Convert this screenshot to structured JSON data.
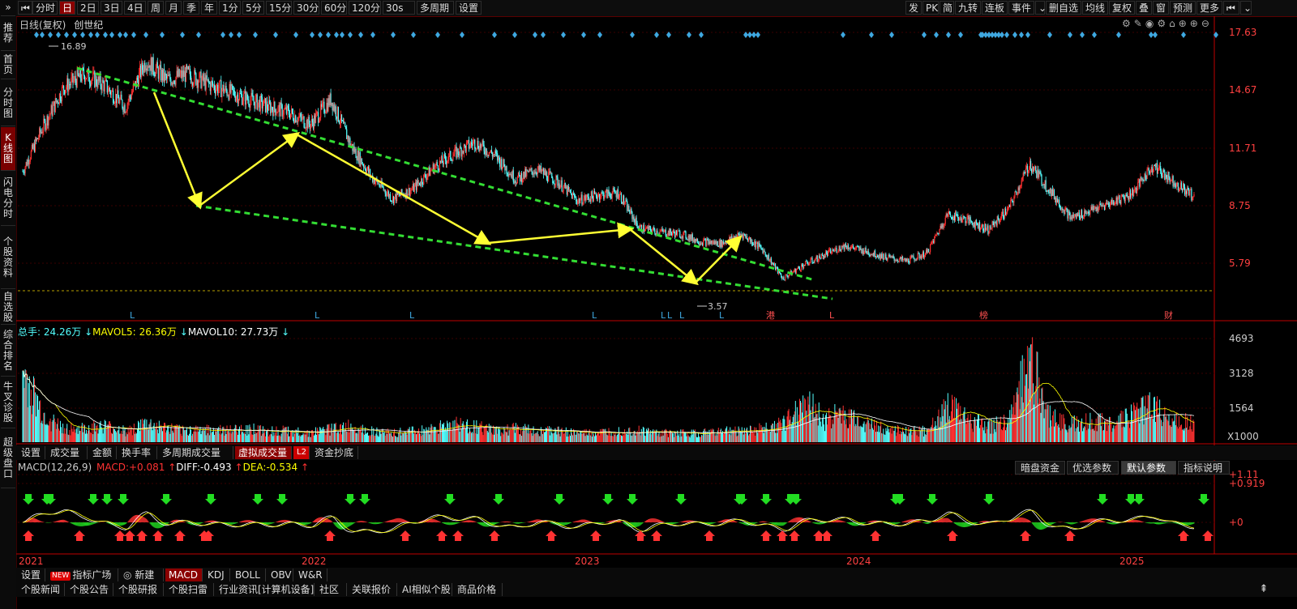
{
  "colors": {
    "up": "#ff3232",
    "down": "#54ffff",
    "grid": "#3a0000",
    "axis": "#c00000",
    "mavol5": "#ffff00",
    "mavol10": "#ffffff",
    "trend": "#33dd33",
    "arrow": "#ffff33",
    "diff": "#ffffff",
    "dea": "#ffff00"
  },
  "sidebar": {
    "items": [
      "推荐",
      "首页",
      "分时图",
      "K线图",
      "闪电分时",
      "个股资料",
      "自选股",
      "综合排名",
      "牛叉诊股",
      "超级盘口"
    ],
    "collapse_icon": "»"
  },
  "toolbar": {
    "prev_icon": "⏮",
    "left": [
      "分时",
      "日",
      "2日",
      "3日",
      "4日",
      "周",
      "月",
      "季",
      "年",
      "1分",
      "5分",
      "15分",
      "30分",
      "60分",
      "120分",
      "30s",
      "多周期",
      "设置"
    ],
    "right": [
      "发",
      "PK",
      "简",
      "九转",
      "连板",
      "事件",
      "⌄",
      "删自选",
      "均线",
      "复权",
      "叠",
      "窗",
      "预测",
      "更多",
      "⏮",
      "⌄"
    ]
  },
  "main": {
    "title": "日线(复权)",
    "stock": "创世纪",
    "y_labels": [
      "17.63",
      "14.67",
      "11.71",
      "8.75",
      "5.79"
    ],
    "high_label": "16.89",
    "low_label": "3.57",
    "markers": [
      "L",
      "L",
      "L",
      "L",
      "L",
      "L",
      "L",
      "L",
      "港",
      "L",
      "榜",
      "财"
    ],
    "tool_icons": [
      "gear-icon",
      "pen-icon",
      "eye-icon",
      "settings-icon",
      "home-icon",
      "add-icon",
      "zoom-in-icon",
      "zoom-out-icon"
    ]
  },
  "volume": {
    "total_label": "总手:",
    "total": "24.26万",
    "mavol5_label": "MAVOL5:",
    "mavol5": "26.36万",
    "mavol10_label": "MAVOL10:",
    "mavol10": "27.73万",
    "y_labels": [
      "4693",
      "3128",
      "1564",
      "X1000"
    ]
  },
  "sub_tabs": [
    "设置",
    "成交量",
    "金额",
    "换手率",
    "多周期成交量",
    "虚拟成交量",
    "L2",
    "资金抄底"
  ],
  "macd": {
    "title": "MACD(12,26,9)",
    "macd_label": "MACD:",
    "macd_val": "+0.081",
    "diff_label": "DIFF:",
    "diff_val": "-0.493",
    "dea_label": "DEA:",
    "dea_val": "-0.534",
    "y_labels": [
      "+1.11",
      "+0.919",
      "+0"
    ],
    "buttons": [
      "暗盘资金",
      "优选参数",
      "默认参数",
      "指标说明"
    ]
  },
  "x_labels": [
    "2021",
    "2022",
    "2023",
    "2024",
    "2025"
  ],
  "indicator_tabs": [
    "设置",
    "指标广场",
    "新建",
    "MACD",
    "KDJ",
    "BOLL",
    "OBV",
    "W&R"
  ],
  "new_badge": "NEW",
  "news_tabs": [
    "个股新闻",
    "个股公告",
    "个股研报",
    "个股扫雷",
    "行业资讯[计算机设备]",
    "社区",
    "关联报价",
    "AI相似个股",
    "商品价格"
  ],
  "chart_data": {
    "type": "candlestick",
    "title": "日线(复权) 创世纪",
    "x_axis": [
      "2021",
      "2022",
      "2023",
      "2024",
      "2025"
    ],
    "price_axis": [
      17.63,
      14.67,
      11.71,
      8.75,
      5.79
    ],
    "monthly_close": [
      {
        "x": "2021-01",
        "y": 10.5
      },
      {
        "x": "2021-02",
        "y": 12.8
      },
      {
        "x": "2021-03",
        "y": 14.8
      },
      {
        "x": "2021-04",
        "y": 15.5
      },
      {
        "x": "2021-05",
        "y": 14.9
      },
      {
        "x": "2021-06",
        "y": 13.8
      },
      {
        "x": "2021-07",
        "y": 16.2
      },
      {
        "x": "2021-08",
        "y": 15.2
      },
      {
        "x": "2021-09",
        "y": 15.5
      },
      {
        "x": "2021-10",
        "y": 15.0
      },
      {
        "x": "2021-11",
        "y": 14.6
      },
      {
        "x": "2021-12",
        "y": 14.2
      },
      {
        "x": "2022-01",
        "y": 13.8
      },
      {
        "x": "2022-02",
        "y": 13.5
      },
      {
        "x": "2022-03",
        "y": 12.9
      },
      {
        "x": "2022-04",
        "y": 14.2
      },
      {
        "x": "2022-05",
        "y": 11.8
      },
      {
        "x": "2022-06",
        "y": 10.2
      },
      {
        "x": "2022-07",
        "y": 9.1
      },
      {
        "x": "2022-08",
        "y": 9.6
      },
      {
        "x": "2022-09",
        "y": 10.7
      },
      {
        "x": "2022-10",
        "y": 11.4
      },
      {
        "x": "2022-11",
        "y": 12.0
      },
      {
        "x": "2022-12",
        "y": 11.3
      },
      {
        "x": "2023-01",
        "y": 10.1
      },
      {
        "x": "2023-02",
        "y": 10.6
      },
      {
        "x": "2023-03",
        "y": 10.0
      },
      {
        "x": "2023-04",
        "y": 9.0
      },
      {
        "x": "2023-05",
        "y": 9.3
      },
      {
        "x": "2023-06",
        "y": 9.4
      },
      {
        "x": "2023-07",
        "y": 7.6
      },
      {
        "x": "2023-08",
        "y": 7.4
      },
      {
        "x": "2023-09",
        "y": 7.3
      },
      {
        "x": "2023-10",
        "y": 6.9
      },
      {
        "x": "2023-11",
        "y": 6.8
      },
      {
        "x": "2023-12",
        "y": 7.3
      },
      {
        "x": "2024-01",
        "y": 6.5
      },
      {
        "x": "2024-02",
        "y": 5.0
      },
      {
        "x": "2024-03",
        "y": 5.7
      },
      {
        "x": "2024-04",
        "y": 6.2
      },
      {
        "x": "2024-05",
        "y": 6.7
      },
      {
        "x": "2024-06",
        "y": 6.4
      },
      {
        "x": "2024-07",
        "y": 6.1
      },
      {
        "x": "2024-08",
        "y": 5.9
      },
      {
        "x": "2024-09",
        "y": 6.3
      },
      {
        "x": "2024-10",
        "y": 8.3
      },
      {
        "x": "2024-11",
        "y": 8.0
      },
      {
        "x": "2024-12",
        "y": 7.5
      },
      {
        "x": "2025-01",
        "y": 8.6
      },
      {
        "x": "2025-02",
        "y": 10.9
      },
      {
        "x": "2025-03",
        "y": 9.5
      },
      {
        "x": "2025-04",
        "y": 8.1
      },
      {
        "x": "2025-05",
        "y": 8.5
      },
      {
        "x": "2025-06",
        "y": 8.9
      },
      {
        "x": "2025-07",
        "y": 9.4
      },
      {
        "x": "2025-08",
        "y": 10.8
      },
      {
        "x": "2025-09",
        "y": 10.0
      },
      {
        "x": "2025-10",
        "y": 9.2
      }
    ],
    "volume_axis": [
      4693,
      3128,
      1564
    ],
    "volume_unit": "X1000",
    "monthly_volume": [
      3.0,
      1.2,
      0.6,
      0.6,
      0.7,
      0.5,
      0.8,
      0.6,
      0.5,
      0.6,
      0.5,
      0.6,
      0.5,
      0.5,
      0.4,
      0.6,
      0.7,
      0.5,
      0.4,
      0.5,
      0.6,
      0.8,
      0.7,
      0.5,
      0.6,
      0.5,
      0.5,
      0.4,
      0.4,
      0.5,
      0.5,
      0.4,
      0.4,
      0.4,
      0.5,
      0.5,
      0.6,
      0.8,
      1.9,
      1.0,
      1.3,
      0.8,
      0.6,
      0.5,
      0.5,
      1.6,
      1.0,
      0.7,
      0.9,
      4.0,
      1.1,
      0.8,
      0.9,
      0.9,
      1.2,
      1.6,
      1.0,
      0.8
    ],
    "macd_axis": [
      1.11,
      0.919,
      0
    ]
  }
}
